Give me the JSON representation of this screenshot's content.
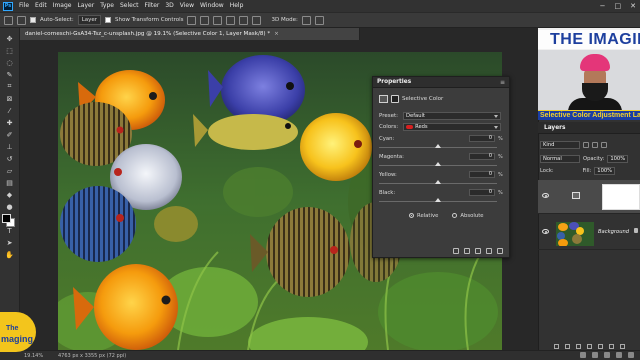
{
  "app": {
    "logo": "Ps"
  },
  "menu": [
    "File",
    "Edit",
    "Image",
    "Layer",
    "Type",
    "Select",
    "Filter",
    "3D",
    "View",
    "Window",
    "Help"
  ],
  "window_controls": [
    "−",
    "□",
    "✕"
  ],
  "options_bar": {
    "auto_select_label": "Auto-Select:",
    "auto_select_value": "Layer",
    "show_transform_label": "Show Transform Controls",
    "mode_3d_label": "3D Mode:"
  },
  "document": {
    "tab_title": "daniel-corneschi-GsA34-Tsz_c-unsplash.jpg @ 19.1% (Selective Color 1, Layer Mask/8) *",
    "close": "×"
  },
  "status": {
    "zoom": "19.14%",
    "doc_info": "4763 px x 3355 px (72 ppi)"
  },
  "properties": {
    "title": "Properties",
    "menu_icon": "≡",
    "subtitle": "Selective Color",
    "preset_label": "Preset:",
    "preset_value": "Default",
    "colors_label": "Colors:",
    "colors_value": "Reds",
    "colors_swatch": "#d82020",
    "sliders": [
      {
        "label": "Cyan:",
        "value": "0",
        "unit": "%",
        "level": 0.5
      },
      {
        "label": "Magenta:",
        "value": "0",
        "unit": "%",
        "level": 0.5
      },
      {
        "label": "Yellow:",
        "value": "0",
        "unit": "%",
        "level": 0.5
      },
      {
        "label": "Black:",
        "value": "0",
        "unit": "%",
        "level": 0.5
      }
    ],
    "method": {
      "relative": "Relative",
      "absolute": "Absolute",
      "selected": "relative"
    }
  },
  "webcam": {
    "banner": "THE IMAGING",
    "caption": "Selective Color Adjustment La",
    "turban_color": "#e43679",
    "caption_bg": "#1b3da3",
    "caption_fg": "#f6d22b"
  },
  "layers": {
    "title": "Layers",
    "kind_label": "Kind",
    "blend_mode": "Normal",
    "opacity_label": "Opacity:",
    "opacity_value": "100%",
    "lock_label": "Lock:",
    "fill_label": "Fill:",
    "fill_value": "100%",
    "background_name": "Background"
  },
  "logo_badge": {
    "line1": "The",
    "line2": "maging"
  }
}
